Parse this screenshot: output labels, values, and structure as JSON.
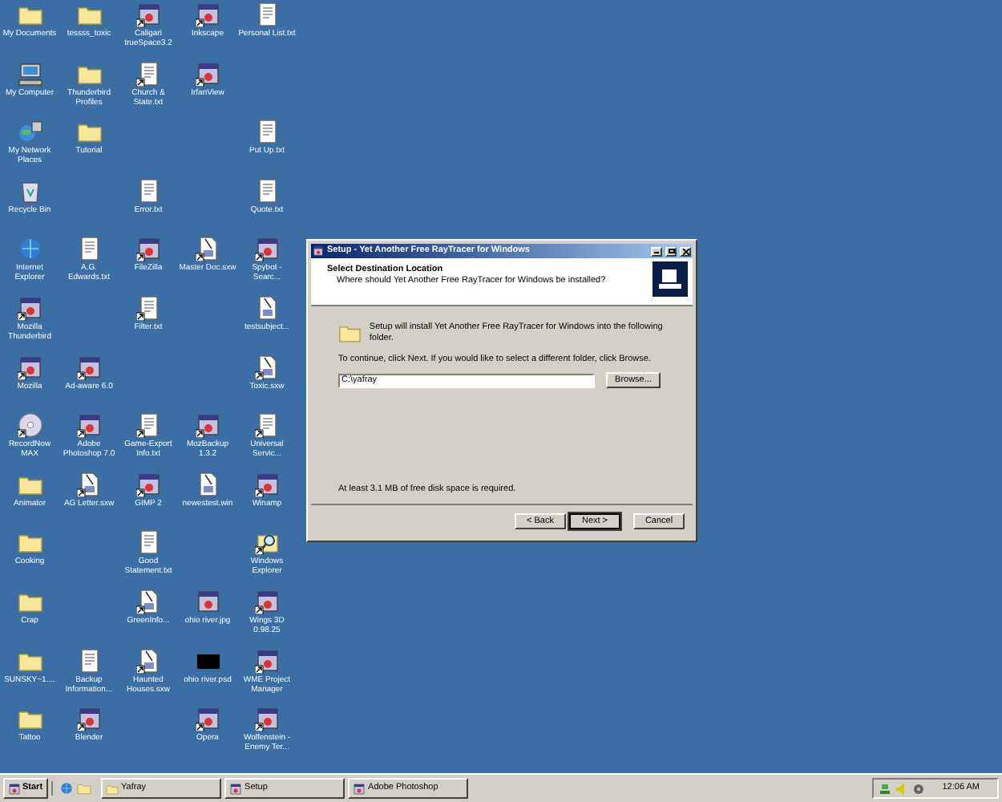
{
  "desktop_icon_rows": [
    [
      {
        "label": "My Documents",
        "kind": "folder"
      },
      {
        "label": "tessss_toxic",
        "kind": "folder"
      },
      {
        "label": "Caligari trueSpace3.2",
        "kind": "program",
        "shortcut": true
      },
      {
        "label": "Inkscape",
        "kind": "program",
        "shortcut": true
      },
      {
        "label": "Personal List.txt",
        "kind": "text"
      }
    ],
    [
      {
        "label": "My Computer",
        "kind": "computer"
      },
      {
        "label": "Thunderbird Profiles",
        "kind": "folder"
      },
      {
        "label": "Church & State.txt",
        "kind": "text",
        "shortcut": true
      },
      {
        "label": "IrfanView",
        "kind": "program",
        "shortcut": true
      },
      null
    ],
    [
      {
        "label": "My Network Places",
        "kind": "network"
      },
      {
        "label": "Tutorial",
        "kind": "folder"
      },
      null,
      null,
      {
        "label": "Put Up.txt",
        "kind": "text"
      }
    ],
    [
      {
        "label": "Recycle Bin",
        "kind": "trash"
      },
      null,
      {
        "label": "Error.txt",
        "kind": "text"
      },
      null,
      {
        "label": "Quote.txt",
        "kind": "text"
      }
    ],
    [
      {
        "label": "Internet Explorer",
        "kind": "browser"
      },
      {
        "label": "A.G. Edwards.txt",
        "kind": "text"
      },
      {
        "label": "FileZilla",
        "kind": "program",
        "shortcut": true
      },
      {
        "label": "Master Doc.sxw",
        "kind": "document",
        "shortcut": true
      },
      {
        "label": "Spybot - Searc...",
        "kind": "program",
        "shortcut": true
      }
    ],
    [
      {
        "label": "Mozilla Thunderbird",
        "kind": "program",
        "shortcut": true
      },
      null,
      {
        "label": "Filter.txt",
        "kind": "text",
        "shortcut": true
      },
      null,
      {
        "label": "testsubject...",
        "kind": "document"
      }
    ],
    [
      {
        "label": "Mozilla",
        "kind": "program",
        "shortcut": true
      },
      {
        "label": "Ad-aware 6.0",
        "kind": "program",
        "shortcut": true
      },
      null,
      null,
      {
        "label": "Toxic.sxw",
        "kind": "document",
        "shortcut": true
      }
    ],
    [
      {
        "label": "RecordNow MAX",
        "kind": "disc",
        "shortcut": true
      },
      {
        "label": "Adobe Photoshop 7.0",
        "kind": "program",
        "shortcut": true
      },
      {
        "label": "Game-Export Info.txt",
        "kind": "text",
        "shortcut": true
      },
      {
        "label": "MozBackup 1.3.2",
        "kind": "program",
        "shortcut": true
      },
      {
        "label": "Universal Servic...",
        "kind": "text",
        "shortcut": true
      }
    ],
    [
      {
        "label": "Animator",
        "kind": "folder"
      },
      {
        "label": "AG Letter.sxw",
        "kind": "document",
        "shortcut": true
      },
      {
        "label": "GIMP 2",
        "kind": "program",
        "shortcut": true
      },
      {
        "label": "newestest.win",
        "kind": "document"
      },
      {
        "label": "Winamp",
        "kind": "program",
        "shortcut": true
      }
    ],
    [
      {
        "label": "Cooking",
        "kind": "folder"
      },
      null,
      {
        "label": "Good Statement.txt",
        "kind": "text"
      },
      null,
      {
        "label": "Windows Explorer",
        "kind": "explorer",
        "shortcut": true
      }
    ],
    [
      {
        "label": "Crap",
        "kind": "folder"
      },
      null,
      {
        "label": "GreenInfo...",
        "kind": "document",
        "shortcut": true
      },
      {
        "label": "ohio river.jpg",
        "kind": "program"
      },
      {
        "label": "Wings 3D 0.98.25",
        "kind": "program",
        "shortcut": true
      }
    ],
    [
      {
        "label": "SUNSKY~1....",
        "kind": "folder"
      },
      {
        "label": "Backup Information...",
        "kind": "text"
      },
      {
        "label": "Haunted Houses.sxw",
        "kind": "document",
        "shortcut": true
      },
      {
        "label": "ohio river.psd",
        "kind": "dark-image"
      },
      {
        "label": "WME Project Manager",
        "kind": "program",
        "shortcut": true
      }
    ],
    [
      {
        "label": "Tattoo",
        "kind": "folder"
      },
      {
        "label": "Blender",
        "kind": "program",
        "shortcut": true
      },
      null,
      {
        "label": "Opera",
        "kind": "program",
        "shortcut": true
      },
      {
        "label": "Wolfenstein - Enemy Ter...",
        "kind": "program",
        "shortcut": true
      }
    ]
  ],
  "setup_window": {
    "title": "Setup - Yet Another Free RayTracer for Windows",
    "active": true,
    "heading": "Select Destination Location",
    "subheading": "Where should Yet Another Free RayTracer for Windows be installed?",
    "install_text": "Setup will install Yet Another Free RayTracer for Windows into the following folder.",
    "continue_text": "To continue, click Next. If you would like to select a different folder, click Browse.",
    "folder_path": "C:\\yafray",
    "browse_button": "Browse...",
    "space_text": "At least 3.1 MB of free disk space is required.",
    "buttons": [
      {
        "label": "< Back",
        "default": false
      },
      {
        "label": "Next >",
        "default": true
      },
      {
        "label": "Cancel",
        "default": false
      }
    ]
  },
  "taskbar": {
    "start": "Start",
    "tasks": [
      {
        "label": "Yafray",
        "kind": "folder",
        "selected": false
      },
      {
        "label": "Setup",
        "kind": "program",
        "selected": false
      },
      {
        "label": "Adobe Photoshop",
        "kind": "program",
        "selected": false
      }
    ],
    "clock": "12:06 AM"
  }
}
